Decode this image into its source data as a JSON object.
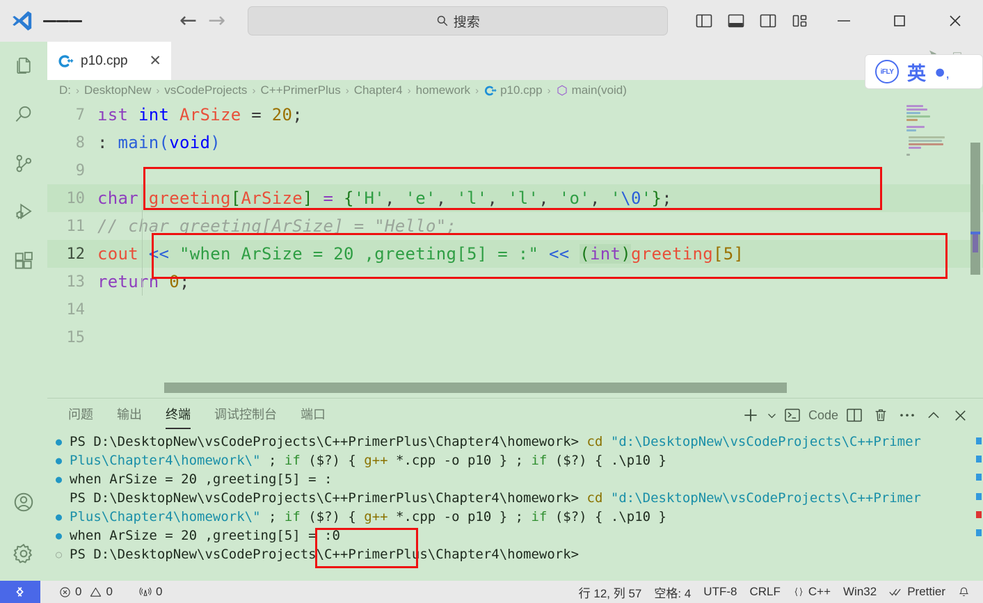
{
  "titlebar": {
    "logo_icon": "vscode-logo-icon",
    "menu_icon": "hamburger-menu-icon",
    "back_icon": "back-arrow-icon",
    "forward_icon": "forward-arrow-icon",
    "search_placeholder": "搜索",
    "search_icon": "search-icon",
    "layout_icons": [
      "toggle-primary-sidebar-icon",
      "toggle-panel-icon",
      "toggle-secondary-sidebar-icon",
      "customize-layout-icon"
    ],
    "window_controls": [
      "minimize-icon",
      "maximize-icon",
      "close-icon"
    ]
  },
  "activitybar": {
    "items": [
      {
        "name": "explorer",
        "icon": "files-icon"
      },
      {
        "name": "search",
        "icon": "search-icon"
      },
      {
        "name": "source-control",
        "icon": "source-control-icon"
      },
      {
        "name": "run-and-debug",
        "icon": "run-debug-icon"
      },
      {
        "name": "extensions",
        "icon": "extensions-icon"
      }
    ],
    "bottom": [
      {
        "name": "accounts",
        "icon": "account-icon"
      },
      {
        "name": "manage",
        "icon": "gear-icon"
      }
    ]
  },
  "tabs": [
    {
      "label": "p10.cpp",
      "icon": "cpp-file-icon",
      "close_icon": "close-icon",
      "active": true
    }
  ],
  "breadcrumb": {
    "segments": [
      "D:",
      "DesktopNew",
      "vsCodeProjects",
      "C++PrimerPlus",
      "Chapter4",
      "homework",
      "p10.cpp",
      "main(void)"
    ],
    "separator": "›",
    "file_icon": "cpp-file-icon",
    "symbol_icon": "symbol-method-icon"
  },
  "editor": {
    "lines": [
      {
        "num": "7",
        "text": "ıst int ArSize = 20;"
      },
      {
        "num": "8",
        "text": ": main(void)"
      },
      {
        "num": "9",
        "text": ""
      },
      {
        "num": "10",
        "text": "char greeting[ArSize] = {'H', 'e', 'l', 'l', 'o', '\\0'};"
      },
      {
        "num": "11",
        "text": "// char greeting[ArSize] = \"Hello\";"
      },
      {
        "num": "12",
        "text": "cout << \"when ArSize = 20 ,greeting[5] = :\" << (int)greeting[5]"
      },
      {
        "num": "13",
        "text": "return 0;"
      },
      {
        "num": "14",
        "text": ""
      },
      {
        "num": "15",
        "text": ""
      }
    ],
    "current_line": "12",
    "annotation_color": "#ee1111",
    "annotations": [
      "highlight-box-line-10",
      "highlight-box-line-12"
    ]
  },
  "panel": {
    "tabs": [
      {
        "label": "问题",
        "active": false
      },
      {
        "label": "输出",
        "active": false
      },
      {
        "label": "终端",
        "active": true
      },
      {
        "label": "调试控制台",
        "active": false
      },
      {
        "label": "端口",
        "active": false
      }
    ],
    "actions": {
      "new_terminal_icon": "plus-icon",
      "new_terminal_dropdown_icon": "chevron-down-icon",
      "shell_icon": "terminal-icon",
      "shell_label": "Code",
      "split_icon": "split-editor-icon",
      "kill_icon": "trash-icon",
      "more_icon": "ellipsis-icon",
      "maximize_icon": "chevron-up-icon",
      "close_icon": "close-icon"
    },
    "terminal_lines": [
      {
        "bullet": "filled",
        "segments": [
          {
            "t": "PS D:\\DesktopNew\\vsCodeProjects\\C++PrimerPlus\\Chapter4\\homework> ",
            "c": "white"
          },
          {
            "t": "cd ",
            "c": "yellow"
          },
          {
            "t": "\"d:\\DesktopNew\\vsCodeProjects\\C++Primer",
            "c": "cyan"
          }
        ]
      },
      {
        "bullet": "filled",
        "segments": [
          {
            "t": "Plus\\Chapter4\\homework\\\" ",
            "c": "cyan"
          },
          {
            "t": "; ",
            "c": "white"
          },
          {
            "t": "if ",
            "c": "green"
          },
          {
            "t": "($?) { ",
            "c": "white"
          },
          {
            "t": "g++ ",
            "c": "yellow"
          },
          {
            "t": "*.cpp -o p10 } ",
            "c": "white"
          },
          {
            "t": "; ",
            "c": "white"
          },
          {
            "t": "if ",
            "c": "green"
          },
          {
            "t": "($?) { ",
            "c": "white"
          },
          {
            "t": ".\\p10 }",
            "c": "white"
          }
        ]
      },
      {
        "bullet": "filled",
        "segments": [
          {
            "t": "when ArSize = 20 ,greeting[5] = :",
            "c": "white"
          }
        ]
      },
      {
        "bullet": "none",
        "segments": [
          {
            "t": "PS D:\\DesktopNew\\vsCodeProjects\\C++PrimerPlus\\Chapter4\\homework> ",
            "c": "white"
          },
          {
            "t": "cd ",
            "c": "yellow"
          },
          {
            "t": "\"d:\\DesktopNew\\vsCodeProjects\\C++Primer",
            "c": "cyan"
          }
        ]
      },
      {
        "bullet": "filled",
        "segments": [
          {
            "t": "Plus\\Chapter4\\homework\\\" ",
            "c": "cyan"
          },
          {
            "t": "; ",
            "c": "white"
          },
          {
            "t": "if ",
            "c": "green"
          },
          {
            "t": "($?) { ",
            "c": "white"
          },
          {
            "t": "g++ ",
            "c": "yellow"
          },
          {
            "t": "*.cpp -o p10 } ",
            "c": "white"
          },
          {
            "t": "; ",
            "c": "white"
          },
          {
            "t": "if ",
            "c": "green"
          },
          {
            "t": "($?) { ",
            "c": "white"
          },
          {
            "t": ".\\p10 }",
            "c": "white"
          }
        ]
      },
      {
        "bullet": "filled",
        "segments": [
          {
            "t": "when ArSize = 20 ,greeting[5] = :0",
            "c": "white"
          }
        ]
      },
      {
        "bullet": "hollow",
        "segments": [
          {
            "t": "PS D:\\DesktopNew\\vsCodeProjects\\C++PrimerPlus\\Chapter4\\homework>",
            "c": "white"
          }
        ]
      }
    ]
  },
  "statusbar": {
    "remote_icon": "remote-window-icon",
    "errors_icon": "error-icon",
    "errors": "0",
    "warnings_icon": "warning-icon",
    "warnings": "0",
    "ports_icon": "radio-tower-icon",
    "ports": "0",
    "cursor_position": "行 12, 列 57",
    "indentation": "空格: 4",
    "encoding": "UTF-8",
    "eol": "CRLF",
    "language_icon": "braces-icon",
    "language": "C++",
    "platform": "Win32",
    "formatter_icon": "check-all-icon",
    "formatter": "Prettier",
    "notifications_icon": "bell-icon"
  },
  "ifly_widget": {
    "logo": "iFLY",
    "mode": "英",
    "icons": [
      "voice-dot-icon",
      "comma-icon"
    ]
  },
  "colors": {
    "editor_background": "#cfe8cf",
    "titlebar_background": "#e9e9e9",
    "accent": "#4a68e8",
    "annotation_red": "#ee1111",
    "active_tab_background": "#ffffff"
  }
}
